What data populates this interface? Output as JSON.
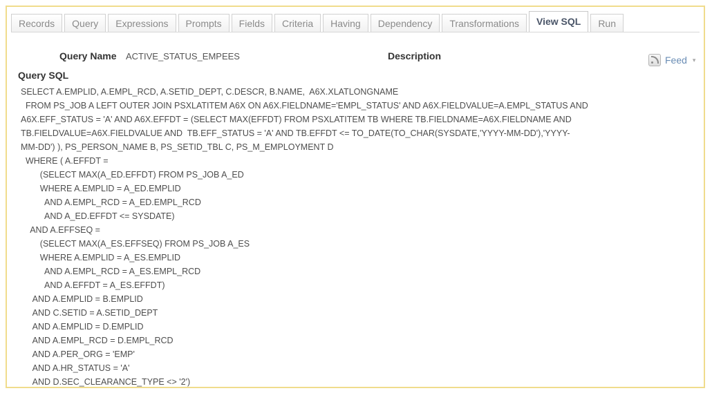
{
  "tabs": [
    {
      "label": "Records",
      "active": false
    },
    {
      "label": "Query",
      "active": false
    },
    {
      "label": "Expressions",
      "active": false
    },
    {
      "label": "Prompts",
      "active": false
    },
    {
      "label": "Fields",
      "active": false
    },
    {
      "label": "Criteria",
      "active": false
    },
    {
      "label": "Having",
      "active": false
    },
    {
      "label": "Dependency",
      "active": false
    },
    {
      "label": "Transformations",
      "active": false
    },
    {
      "label": "View SQL",
      "active": true
    },
    {
      "label": "Run",
      "active": false
    }
  ],
  "query": {
    "name_label": "Query Name",
    "name_value": "ACTIVE_STATUS_EMPEES",
    "description_label": "Description"
  },
  "feed": {
    "label": "Feed",
    "icon": "rss-feed-icon",
    "caret": "▾"
  },
  "sql": {
    "label": "Query SQL",
    "lines": [
      "SELECT A.EMPLID, A.EMPL_RCD, A.SETID_DEPT, C.DESCR, B.NAME,  A6X.XLATLONGNAME",
      "  FROM PS_JOB A LEFT OUTER JOIN PSXLATITEM A6X ON A6X.FIELDNAME='EMPL_STATUS' AND A6X.FIELDVALUE=A.EMPL_STATUS AND",
      "A6X.EFF_STATUS = 'A' AND A6X.EFFDT = (SELECT MAX(EFFDT) FROM PSXLATITEM TB WHERE TB.FIELDNAME=A6X.FIELDNAME AND",
      "TB.FIELDVALUE=A6X.FIELDVALUE AND  TB.EFF_STATUS = 'A' AND TB.EFFDT <= TO_DATE(TO_CHAR(SYSDATE,'YYYY-MM-DD'),'YYYY-",
      "MM-DD') ), PS_PERSON_NAME B, PS_SETID_TBL C, PS_M_EMPLOYMENT D",
      "  WHERE ( A.EFFDT =",
      "        (SELECT MAX(A_ED.EFFDT) FROM PS_JOB A_ED",
      "        WHERE A.EMPLID = A_ED.EMPLID",
      "          AND A.EMPL_RCD = A_ED.EMPL_RCD",
      "          AND A_ED.EFFDT <= SYSDATE)",
      "    AND A.EFFSEQ =",
      "        (SELECT MAX(A_ES.EFFSEQ) FROM PS_JOB A_ES",
      "        WHERE A.EMPLID = A_ES.EMPLID",
      "          AND A.EMPL_RCD = A_ES.EMPL_RCD",
      "          AND A.EFFDT = A_ES.EFFDT)",
      "     AND A.EMPLID = B.EMPLID",
      "     AND C.SETID = A.SETID_DEPT",
      "     AND A.EMPLID = D.EMPLID",
      "     AND A.EMPL_RCD = D.EMPL_RCD",
      "     AND A.PER_ORG = 'EMP'",
      "     AND A.HR_STATUS = 'A'",
      "     AND D.SEC_CLEARANCE_TYPE <> '2')"
    ]
  }
}
